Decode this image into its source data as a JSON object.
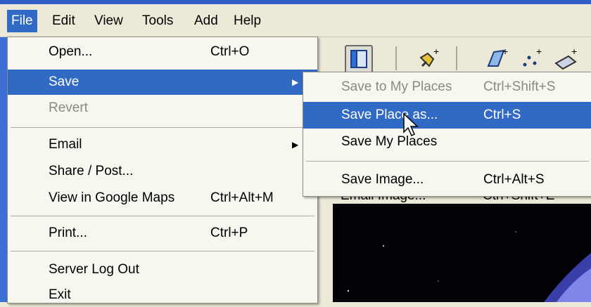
{
  "menubar": {
    "items": [
      "File",
      "Edit",
      "View",
      "Tools",
      "Add",
      "Help"
    ]
  },
  "file_menu": {
    "open": {
      "label": "Open...",
      "shortcut": "Ctrl+O"
    },
    "save": {
      "label": "Save"
    },
    "revert": {
      "label": "Revert"
    },
    "email": {
      "label": "Email"
    },
    "share": {
      "label": "Share / Post..."
    },
    "view_maps": {
      "label": "View in Google Maps",
      "shortcut": "Ctrl+Alt+M"
    },
    "print": {
      "label": "Print...",
      "shortcut": "Ctrl+P"
    },
    "server_logout": {
      "label": "Server Log Out"
    },
    "exit": {
      "label": "Exit"
    }
  },
  "save_submenu": {
    "save_to_my_places": {
      "label": "Save to My Places",
      "shortcut": "Ctrl+Shift+S"
    },
    "save_place_as": {
      "label": "Save Place as...",
      "shortcut": "Ctrl+S"
    },
    "save_my_places": {
      "label": "Save My Places"
    },
    "save_image": {
      "label": "Save Image...",
      "shortcut": "Ctrl+Alt+S"
    },
    "email_image_partial": {
      "label": "Email Image...",
      "shortcut": "Ctrl+Shift+E"
    }
  },
  "colors": {
    "highlight": "#316ac5",
    "menu_bg": "#f7f6ef",
    "chrome_bg": "#ece9d8"
  }
}
